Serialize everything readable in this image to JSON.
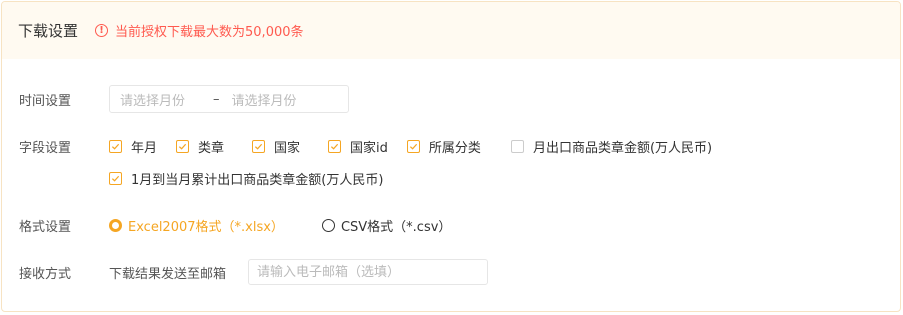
{
  "header": {
    "title": "下载设置",
    "warning": "当前授权下载最大数为50,000条"
  },
  "time": {
    "label": "时间设置",
    "start_placeholder": "请选择月份",
    "separator": "–",
    "end_placeholder": "请选择月份"
  },
  "fields": {
    "label": "字段设置",
    "items": [
      {
        "label": "年月",
        "checked": true
      },
      {
        "label": "类章",
        "checked": true
      },
      {
        "label": "国家",
        "checked": true
      },
      {
        "label": "国家id",
        "checked": true
      },
      {
        "label": "所属分类",
        "checked": true
      },
      {
        "label": "月出口商品类章金额(万人民币)",
        "checked": false
      },
      {
        "label": "1月到当月累计出口商品类章金额(万人民币)",
        "checked": true
      }
    ]
  },
  "format": {
    "label": "格式设置",
    "options": [
      {
        "label": "Excel2007格式（*.xlsx）",
        "selected": true
      },
      {
        "label": "CSV格式（*.csv）",
        "selected": false
      }
    ]
  },
  "receive": {
    "label": "接收方式",
    "text": "下载结果发送至邮箱",
    "email_placeholder": "请输入电子邮箱（选填）"
  },
  "colors": {
    "accent": "#f5a623",
    "warning": "#ff5a4f",
    "header_bg": "#fffaf1"
  }
}
